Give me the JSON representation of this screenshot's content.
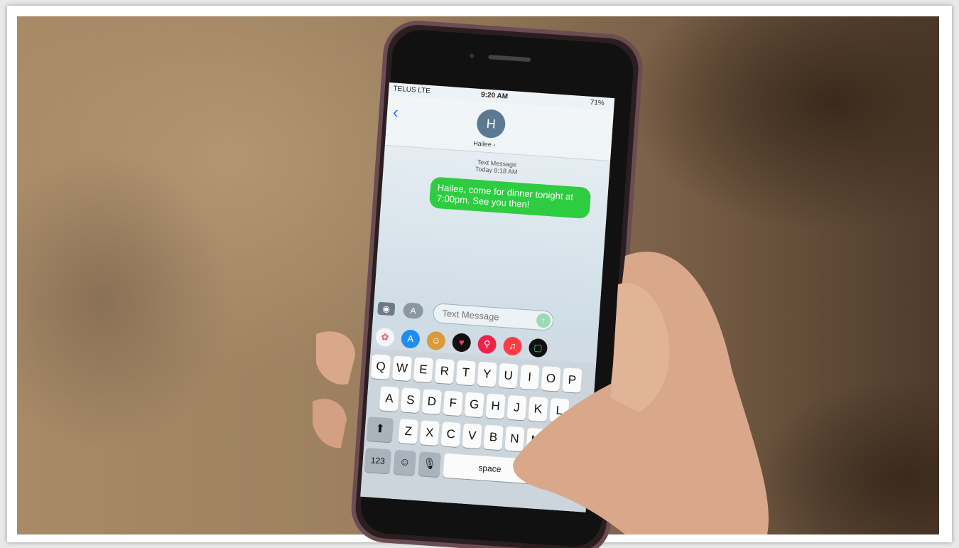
{
  "status": {
    "carrier": "TELUS  LTE",
    "time": "9:20 AM",
    "battery": "71%"
  },
  "contact": {
    "initial": "H",
    "name": "Hailee ›"
  },
  "thread": {
    "meta_type": "Text Message",
    "meta_time": "Today 9:18 AM",
    "message": "Hailee, come for dinner tonight at 7:00pm. See you then!"
  },
  "composer": {
    "placeholder": "Text Message"
  },
  "keyboard": {
    "row1": [
      "Q",
      "W",
      "E",
      "R",
      "T",
      "Y",
      "U",
      "I",
      "O",
      "P"
    ],
    "row2": [
      "A",
      "S",
      "D",
      "F",
      "G",
      "H",
      "J",
      "K",
      "L"
    ],
    "row3": [
      "Z",
      "X",
      "C",
      "V",
      "B",
      "N",
      "M"
    ],
    "numbers_label": "123",
    "space_label": "space"
  },
  "colors": {
    "bubble": "#2ecc40",
    "accent": "#1f7cf3"
  },
  "app_strip_icons": [
    "photos-icon",
    "app-store-icon",
    "animoji-icon",
    "heart-icon",
    "search-icon",
    "music-icon",
    "app-icon"
  ]
}
